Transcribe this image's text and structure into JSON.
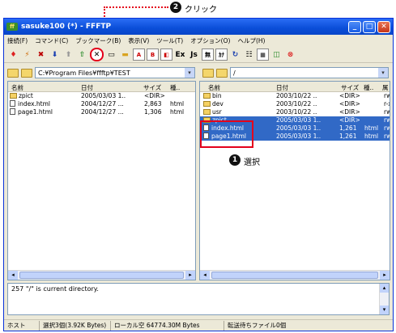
{
  "annotations": {
    "click_badge": "2",
    "click_label": "クリック",
    "select_badge": "1",
    "select_label": "選択"
  },
  "window": {
    "title": "sasuke100 (*) - FFFTP",
    "min": "_",
    "max": "□",
    "close": "✕"
  },
  "menu": [
    "接続(F)",
    "コマンド(C)",
    "ブックマーク(B)",
    "表示(V)",
    "ツール(T)",
    "オプション(O)",
    "ヘルプ(H)"
  ],
  "toolbar": {
    "buttons": [
      "connect",
      "quick",
      "disconnect",
      "download",
      "upload",
      "sync",
      "delete",
      "rename",
      "mkdir",
      "A",
      "B",
      "mixed",
      "Ex",
      "Js",
      "無",
      "ｶﾅ",
      "refresh",
      "list",
      "detail",
      "filter",
      "stop"
    ],
    "delete_label": "✕"
  },
  "left": {
    "path": "C:¥Program Files¥ffftp¥TEST",
    "headers": [
      "名前",
      "日付",
      "サイズ",
      "種.."
    ],
    "rows": [
      {
        "name": "zpict",
        "date": "2005/03/03 1..",
        "size": "<DIR>",
        "type": "",
        "kind": "folder"
      },
      {
        "name": "index.html",
        "date": "2004/12/27 ...",
        "size": "2,863",
        "type": "html",
        "kind": "file"
      },
      {
        "name": "page1.html",
        "date": "2004/12/27 ...",
        "size": "1,306",
        "type": "html",
        "kind": "file"
      }
    ]
  },
  "right": {
    "path": "/",
    "headers": [
      "名前",
      "日付",
      "サイズ",
      "種..",
      "属"
    ],
    "rows": [
      {
        "name": "bin",
        "date": "2003/10/22 ..",
        "size": "<DIR>",
        "type": "",
        "attr": "rwx",
        "kind": "folder",
        "sel": false
      },
      {
        "name": "dev",
        "date": "2003/10/22 ..",
        "size": "<DIR>",
        "type": "",
        "attr": "r-x",
        "kind": "folder",
        "sel": false
      },
      {
        "name": "usr",
        "date": "2003/10/22 ..",
        "size": "<DIR>",
        "type": "",
        "attr": "rwx",
        "kind": "folder",
        "sel": false
      },
      {
        "name": "zpict",
        "date": "2005/03/03 1..",
        "size": "<DIR>",
        "type": "",
        "attr": "rwx",
        "kind": "folder",
        "sel": true
      },
      {
        "name": "index.html",
        "date": "2005/03/03 1..",
        "size": "1,261",
        "type": "html",
        "attr": "rwx",
        "kind": "file",
        "sel": true
      },
      {
        "name": "page1.html",
        "date": "2005/03/03 1..",
        "size": "1,261",
        "type": "html",
        "attr": "rwx",
        "kind": "file",
        "sel": true
      }
    ]
  },
  "log": {
    "text": "257 \"/\" is current directory."
  },
  "status": {
    "host": "ホスト",
    "selected": "選択3個(3.92K Bytes)",
    "local": "ローカル空 64774.30M Bytes",
    "queue": "転送待ちファイル0個"
  }
}
